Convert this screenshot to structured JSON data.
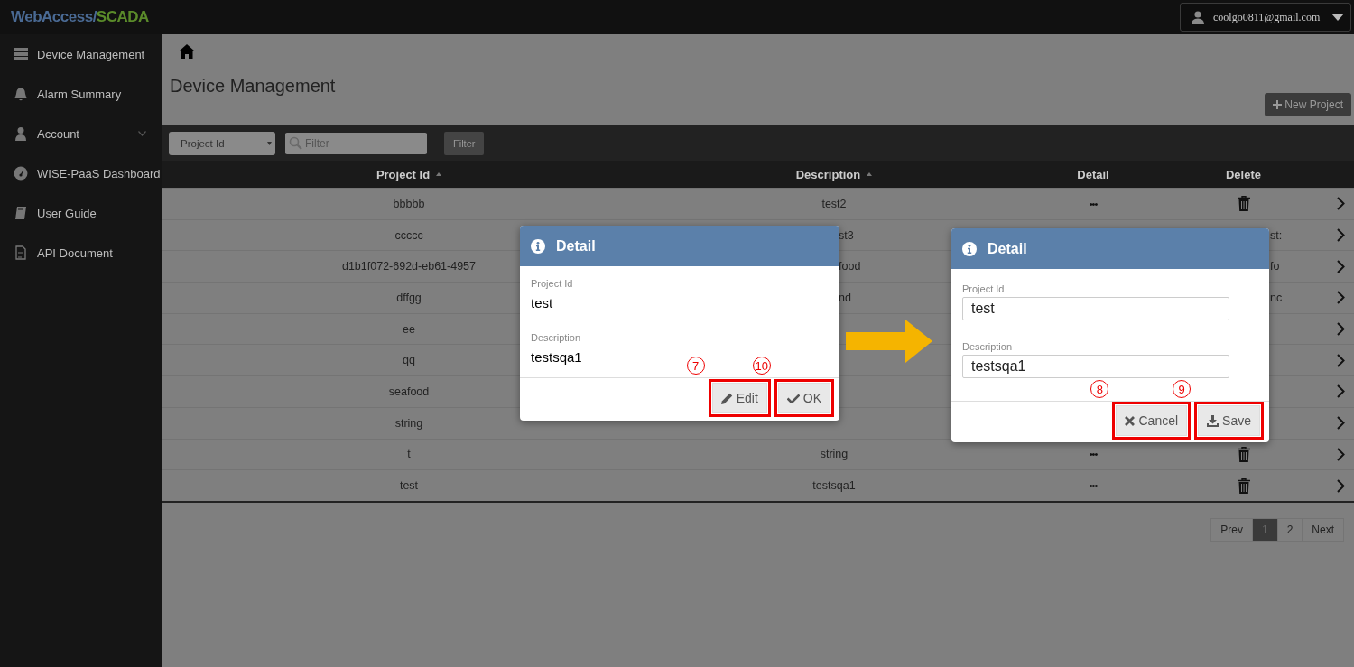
{
  "header": {
    "logo": {
      "primary": "WebAccess/",
      "accent": "SCADA"
    },
    "user": {
      "email": "coolgo0811@gmail.com"
    }
  },
  "sidebar": {
    "items": [
      {
        "label": "Device Management",
        "kind": "link"
      },
      {
        "label": "Alarm Summary",
        "kind": "link"
      },
      {
        "label": "Account",
        "kind": "group"
      },
      {
        "label": "WISE-PaaS Dashboard",
        "kind": "link"
      },
      {
        "label": "User Guide",
        "kind": "link"
      },
      {
        "label": "API Document",
        "kind": "link"
      }
    ]
  },
  "page": {
    "title": "Device Management",
    "new_button": "New Project"
  },
  "filter": {
    "field": "Project Id",
    "placeholder": "Filter",
    "button": "Filter"
  },
  "table": {
    "columns": [
      {
        "label": "Project Id",
        "sortable": true
      },
      {
        "label": "Description",
        "sortable": true
      },
      {
        "label": "Detail",
        "sortable": false
      },
      {
        "label": "Delete",
        "sortable": false
      }
    ],
    "rows": [
      {
        "kind": "full",
        "project_id": "bbbbb",
        "description": "test2",
        "detail": "•••"
      },
      {
        "kind": "covered",
        "project_id": "ccccc",
        "description": "st3",
        "fragment": "st:"
      },
      {
        "kind": "covered",
        "project_id": "d1b1f072-692d-eb61-4957",
        "description": "food",
        "fragment": "fo"
      },
      {
        "kind": "covered",
        "project_id": "dffgg",
        "description": "nd",
        "fragment": "nc"
      },
      {
        "kind": "covered",
        "project_id": "ee"
      },
      {
        "kind": "covered",
        "project_id": "qq"
      },
      {
        "kind": "covered",
        "project_id": "seafood"
      },
      {
        "kind": "covered",
        "project_id": "string"
      },
      {
        "kind": "full",
        "project_id": "t",
        "description": "string",
        "detail": "•••"
      },
      {
        "kind": "full",
        "project_id": "test",
        "description": "testsqa1",
        "detail": "•••"
      }
    ]
  },
  "pagination": [
    {
      "label": "Prev",
      "selected": false
    },
    {
      "label": "1",
      "selected": true
    },
    {
      "label": "2",
      "selected": false
    },
    {
      "label": "Next",
      "selected": false
    }
  ],
  "dialogs": [
    {
      "kind": "view",
      "title": "Detail",
      "fields": [
        {
          "label": "Project Id",
          "value": "test"
        },
        {
          "label": "Description",
          "value": "testsqa1"
        }
      ],
      "buttons": [
        {
          "label": "Edit",
          "step": "7"
        },
        {
          "label": "OK",
          "step": "10"
        }
      ]
    },
    {
      "kind": "edit",
      "title": "Detail",
      "fields": [
        {
          "label": "Project Id",
          "value": "test"
        },
        {
          "label": "Description",
          "value": "testsqa1"
        }
      ],
      "buttons": [
        {
          "label": "Cancel",
          "step": "8"
        },
        {
          "label": "Save",
          "step": "9"
        }
      ]
    }
  ]
}
